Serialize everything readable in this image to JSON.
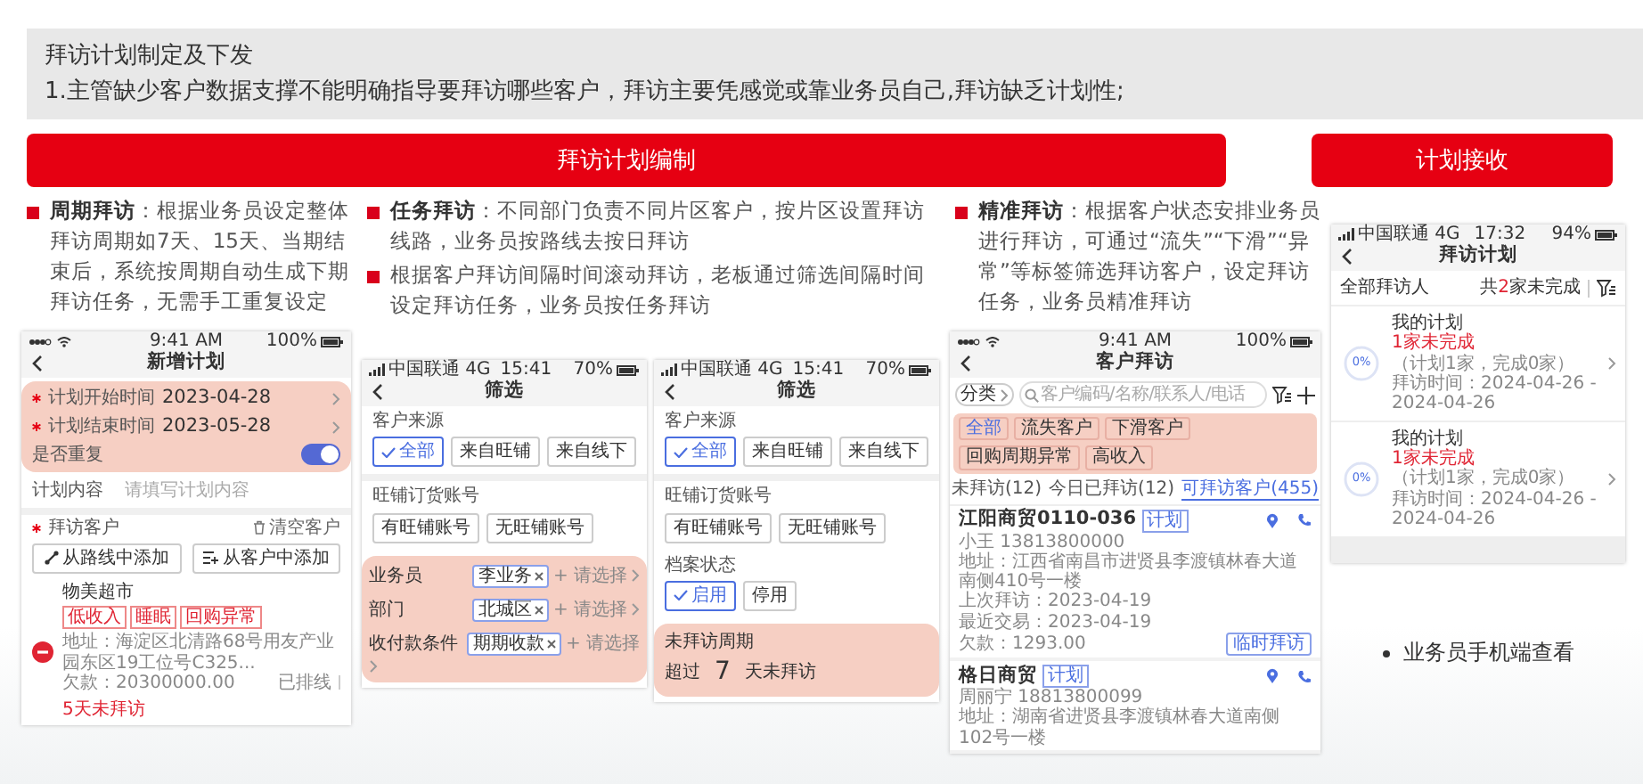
{
  "header": {
    "title": "拜访计划制定及下发",
    "subtitle": "1.主管缺少客户数据支撑不能明确指导要拜访哪些客户，拜访主要凭感觉或靠业务员自己,拜访缺乏计划性;"
  },
  "banners": [
    "拜访计划编制",
    "计划接收"
  ],
  "columns": [
    {
      "points": [
        "**周期拜访**：根据业务员设定整体拜访周期如7天、15天、当期结束后，系统按周期自动生成下期拜访任务，无需手工重复设定"
      ],
      "phones": [
        {
          "kind": "new_plan",
          "status": {
            "time": "9:41 AM",
            "battery": "100%"
          },
          "title": "新增计划",
          "fields": [
            {
              "label": "计划开始时间",
              "value": "2023-04-28",
              "required": true
            },
            {
              "label": "计划结束时间",
              "value": "2023-05-28",
              "required": true
            }
          ],
          "repeat": {
            "label": "是否重复",
            "on": true
          },
          "content": {
            "label": "计划内容",
            "placeholder": "请填写计划内容"
          },
          "customers": {
            "label": "拜访客户",
            "required": true,
            "clear": "清空客户",
            "buttons": [
              "从路线中添加",
              "从客户中添加"
            ],
            "items": [
              {
                "name": "物美超市",
                "tags": [
                  "低收入",
                  "睡眠",
                  "回购异常"
                ],
                "address": "地址：海淀区北清路68号用友产业园东区19工位号C325...",
                "debt": "欠款：20300000.00",
                "route": "已排线",
                "overdue": "5天未拜访"
              }
            ]
          }
        }
      ]
    },
    {
      "points": [
        "**任务拜访**：不同部门负责不同片区客户，按片区设置拜访线路，业务员按路线去按日拜访",
        "根据客户拜访间隔时间滚动拜访，老板通过筛选间隔时间设定拜访任务，业务员按任务拜访"
      ],
      "phones": [
        {
          "kind": "filter",
          "status": {
            "carrier": "中国联通 4G",
            "time": "15:41",
            "battery": "70%"
          },
          "title": "筛选",
          "groups": [
            {
              "label": "客户来源",
              "chips": [
                {
                  "label": "全部",
                  "selected": true
                },
                {
                  "label": "来自旺铺",
                  "selected": false
                },
                {
                  "label": "来自线下",
                  "selected": false
                }
              ]
            },
            {
              "label": "旺铺订货账号",
              "chips": [
                {
                  "label": "有旺铺账号",
                  "selected": false
                },
                {
                  "label": "无旺铺账号",
                  "selected": false
                }
              ]
            }
          ],
          "pickers": [
            {
              "label": "业务员",
              "tag": "李业务",
              "placeholder": "+ 请选择"
            },
            {
              "label": "部门",
              "tag": "北城区",
              "placeholder": "+ 请选择"
            },
            {
              "label": "收付款条件",
              "tag": "期期收款",
              "placeholder": "+ 请选择"
            }
          ]
        },
        {
          "kind": "filter",
          "status": {
            "carrier": "中国联通 4G",
            "time": "15:41",
            "battery": "70%"
          },
          "title": "筛选",
          "groups": [
            {
              "label": "客户来源",
              "chips": [
                {
                  "label": "全部",
                  "selected": true
                },
                {
                  "label": "来自旺铺",
                  "selected": false
                },
                {
                  "label": "来自线下",
                  "selected": false
                }
              ]
            },
            {
              "label": "旺铺订货账号",
              "chips": [
                {
                  "label": "有旺铺账号",
                  "selected": false
                },
                {
                  "label": "无旺铺账号",
                  "selected": false
                }
              ]
            },
            {
              "label": "档案状态",
              "chips": [
                {
                  "label": "启用",
                  "selected": true
                },
                {
                  "label": "停用",
                  "selected": false
                }
              ]
            }
          ],
          "period": {
            "label": "未拜访周期",
            "prefix": "超过",
            "value": "7",
            "suffix": "天未拜访"
          }
        }
      ]
    },
    {
      "points": [
        "**精准拜访**：根据客户状态安排业务员进行拜访，可通过“流失”“下滑”“异常”等标签筛选拜访客户，设定拜访任务，业务员精准拜访"
      ],
      "phones": [
        {
          "kind": "visit_list",
          "status": {
            "time": "9:41 AM",
            "battery": "100%"
          },
          "title": "客户拜访",
          "category": "分类",
          "search_placeholder": "客户编码/名称/联系人/电话",
          "tags": [
            {
              "label": "全部",
              "selected": true
            },
            {
              "label": "流失客户",
              "selected": false
            },
            {
              "label": "下滑客户",
              "selected": false
            },
            {
              "label": "回购周期异常",
              "selected": false
            },
            {
              "label": "高收入",
              "selected": false
            }
          ],
          "tabs": [
            {
              "label": "未拜访(12)",
              "selected": false
            },
            {
              "label": "今日已拜访(12)",
              "selected": false
            },
            {
              "label": "可拜访客户(455)",
              "selected": true
            }
          ],
          "customers": [
            {
              "name": "江阳商贸0110-036",
              "badge": "计划",
              "lines": [
                "小王 13813800000",
                "地址：江西省南昌市进贤县李渡镇林春大道南侧410号一楼",
                "上次拜访：2023-04-19",
                "最近交易：2023-04-19",
                "欠款：1293.00"
              ],
              "action": "临时拜访"
            },
            {
              "name": "格日商贸",
              "badge": "计划",
              "lines": [
                "周丽宁 18813800099",
                "地址：湖南省进贤县李渡镇林春大道南侧102号一楼"
              ]
            }
          ]
        }
      ]
    },
    {
      "phones": [
        {
          "kind": "plan_list",
          "status": {
            "carrier": "中国联通 4G",
            "time": "17:32",
            "battery": "94%"
          },
          "title": "拜访计划",
          "filter_label": "全部拜访人",
          "summary": {
            "prefix": "共",
            "count": "2",
            "suffix": "家未完成"
          },
          "plans": [
            {
              "level": 0,
              "progress": "0%",
              "title": "我的计划",
              "pending": "1家未完成",
              "detail": "（计划1家，完成0家）",
              "time": "拜访时间：2024-04-26 - 2024-04-26"
            },
            {
              "level": 0,
              "progress": "0%",
              "title": "我的计划",
              "pending": "1家未完成",
              "detail": "（计划1家，完成0家）",
              "time": "拜访时间：2024-04-26 - 2024-04-26"
            }
          ]
        }
      ],
      "note": "业务员手机端查看"
    }
  ]
}
